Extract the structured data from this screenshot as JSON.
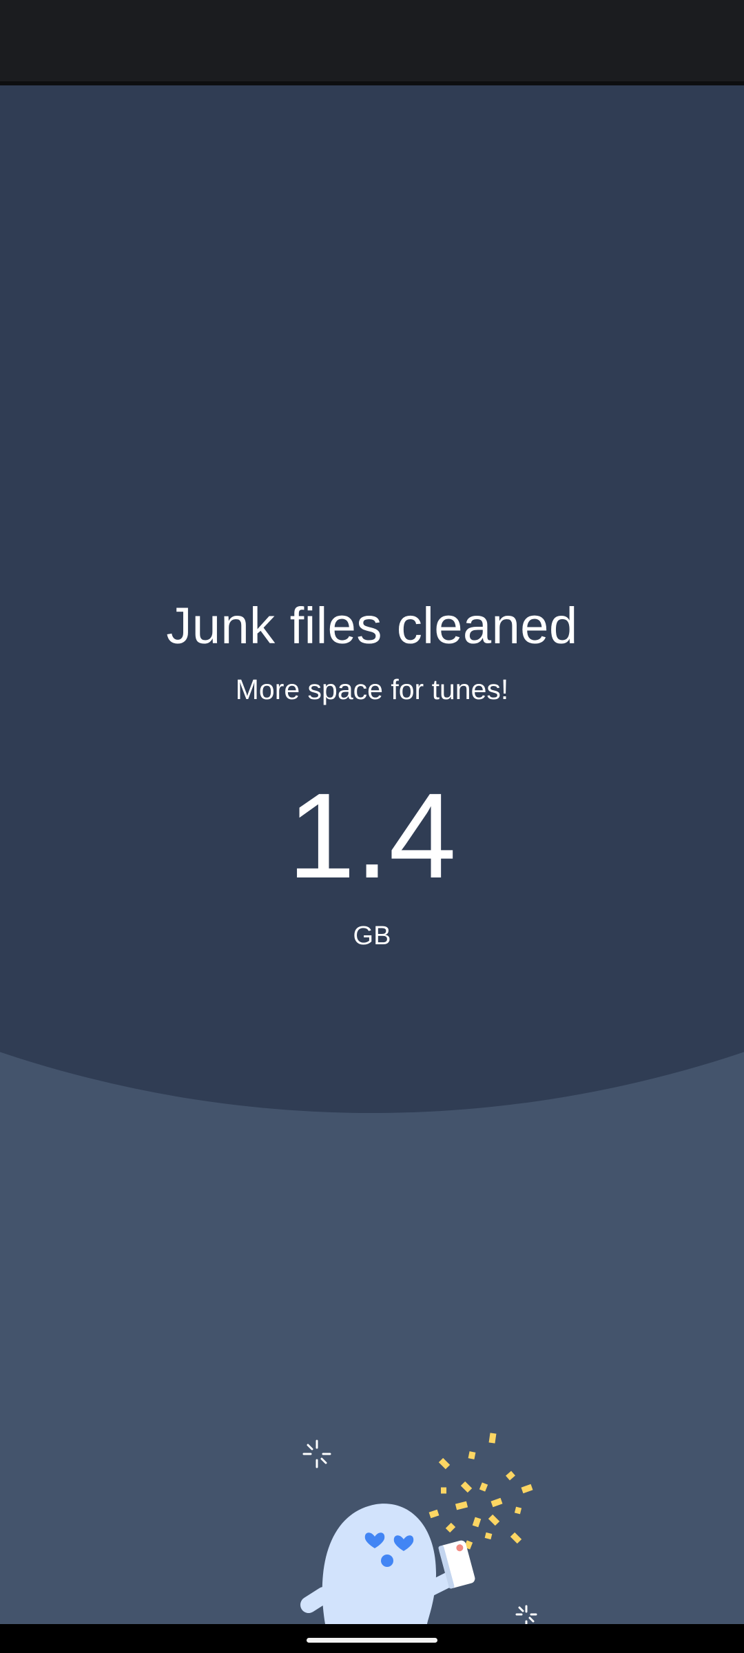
{
  "result": {
    "title": "Junk files cleaned",
    "subtitle": "More space for tunes!",
    "amount": "1.4",
    "unit": "GB"
  },
  "illustration": {
    "name": "celebrating-mascot-with-phone",
    "colors": {
      "mascot": "#d2e3fc",
      "hearts": "#4285f4",
      "confetti": "#fdd663",
      "phone": "#ffffff",
      "phone_dot": "#f28b82"
    }
  },
  "theme": {
    "background": "#44546c",
    "panel": "#303d54",
    "status_bar": "#1b1c1f",
    "text": "#ffffff"
  }
}
